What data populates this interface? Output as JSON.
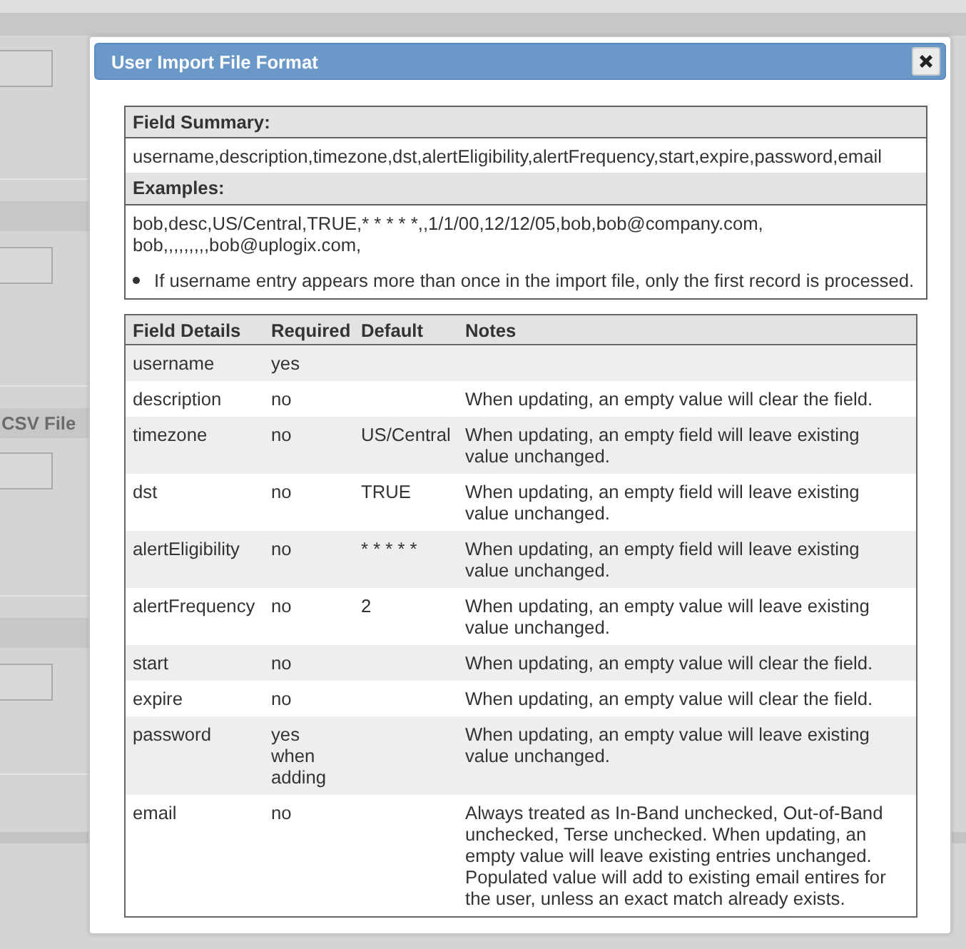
{
  "background_page": {
    "section_title": "CSV File"
  },
  "dialog": {
    "title": "User Import File Format"
  },
  "summary_table": {
    "field_summary": {
      "heading": "Field Summary:",
      "text": "username,description,timezone,dst,alertEligibility,alertFrequency,start,expire,password,email"
    },
    "examples": {
      "heading": "Examples:",
      "lines": [
        "bob,desc,US/Central,TRUE,* * * * *,,1/1/00,12/12/05,bob,bob@company.com,",
        "bob,,,,,,,,,bob@uplogix.com,"
      ],
      "notes": [
        "If username entry appears more than once in the import file, only the first record is processed."
      ]
    }
  },
  "details_table": {
    "columns": [
      "Field Details",
      "Required",
      "Default",
      "Notes"
    ],
    "rows": [
      {
        "field": "username",
        "required": "yes"
      },
      {
        "field": "description",
        "required": "no",
        "notes": "When updating, an empty value will clear the field."
      },
      {
        "field": "timezone",
        "required": "no",
        "default": "US/Central",
        "notes": "When updating, an empty field will leave existing value unchanged."
      },
      {
        "field": "dst",
        "required": "no",
        "default": "TRUE",
        "notes": "When updating, an empty field will leave existing value unchanged."
      },
      {
        "field": "alertEligibility",
        "required": "no",
        "default": "* * * * *",
        "notes": "When updating, an empty field will leave existing value unchanged."
      },
      {
        "field": "alertFrequency",
        "required": "no",
        "default": "2",
        "notes": "When updating, an empty value will leave existing value unchanged."
      },
      {
        "field": "start",
        "required": "no",
        "notes": "When updating, an empty value will clear the field."
      },
      {
        "field": "expire",
        "required": "no",
        "notes": "When updating, an empty value will clear the field."
      },
      {
        "field": "password",
        "required": "yes when adding",
        "notes": "When updating, an empty value will leave existing value unchanged."
      },
      {
        "field": "email",
        "required": "no",
        "notes": "Always treated as In-Band unchecked, Out-of-Band unchecked, Terse unchecked. When updating, an empty value will leave existing entries unchanged. Populated value will add to existing email entires for the user, unless an exact match already exists."
      }
    ]
  }
}
